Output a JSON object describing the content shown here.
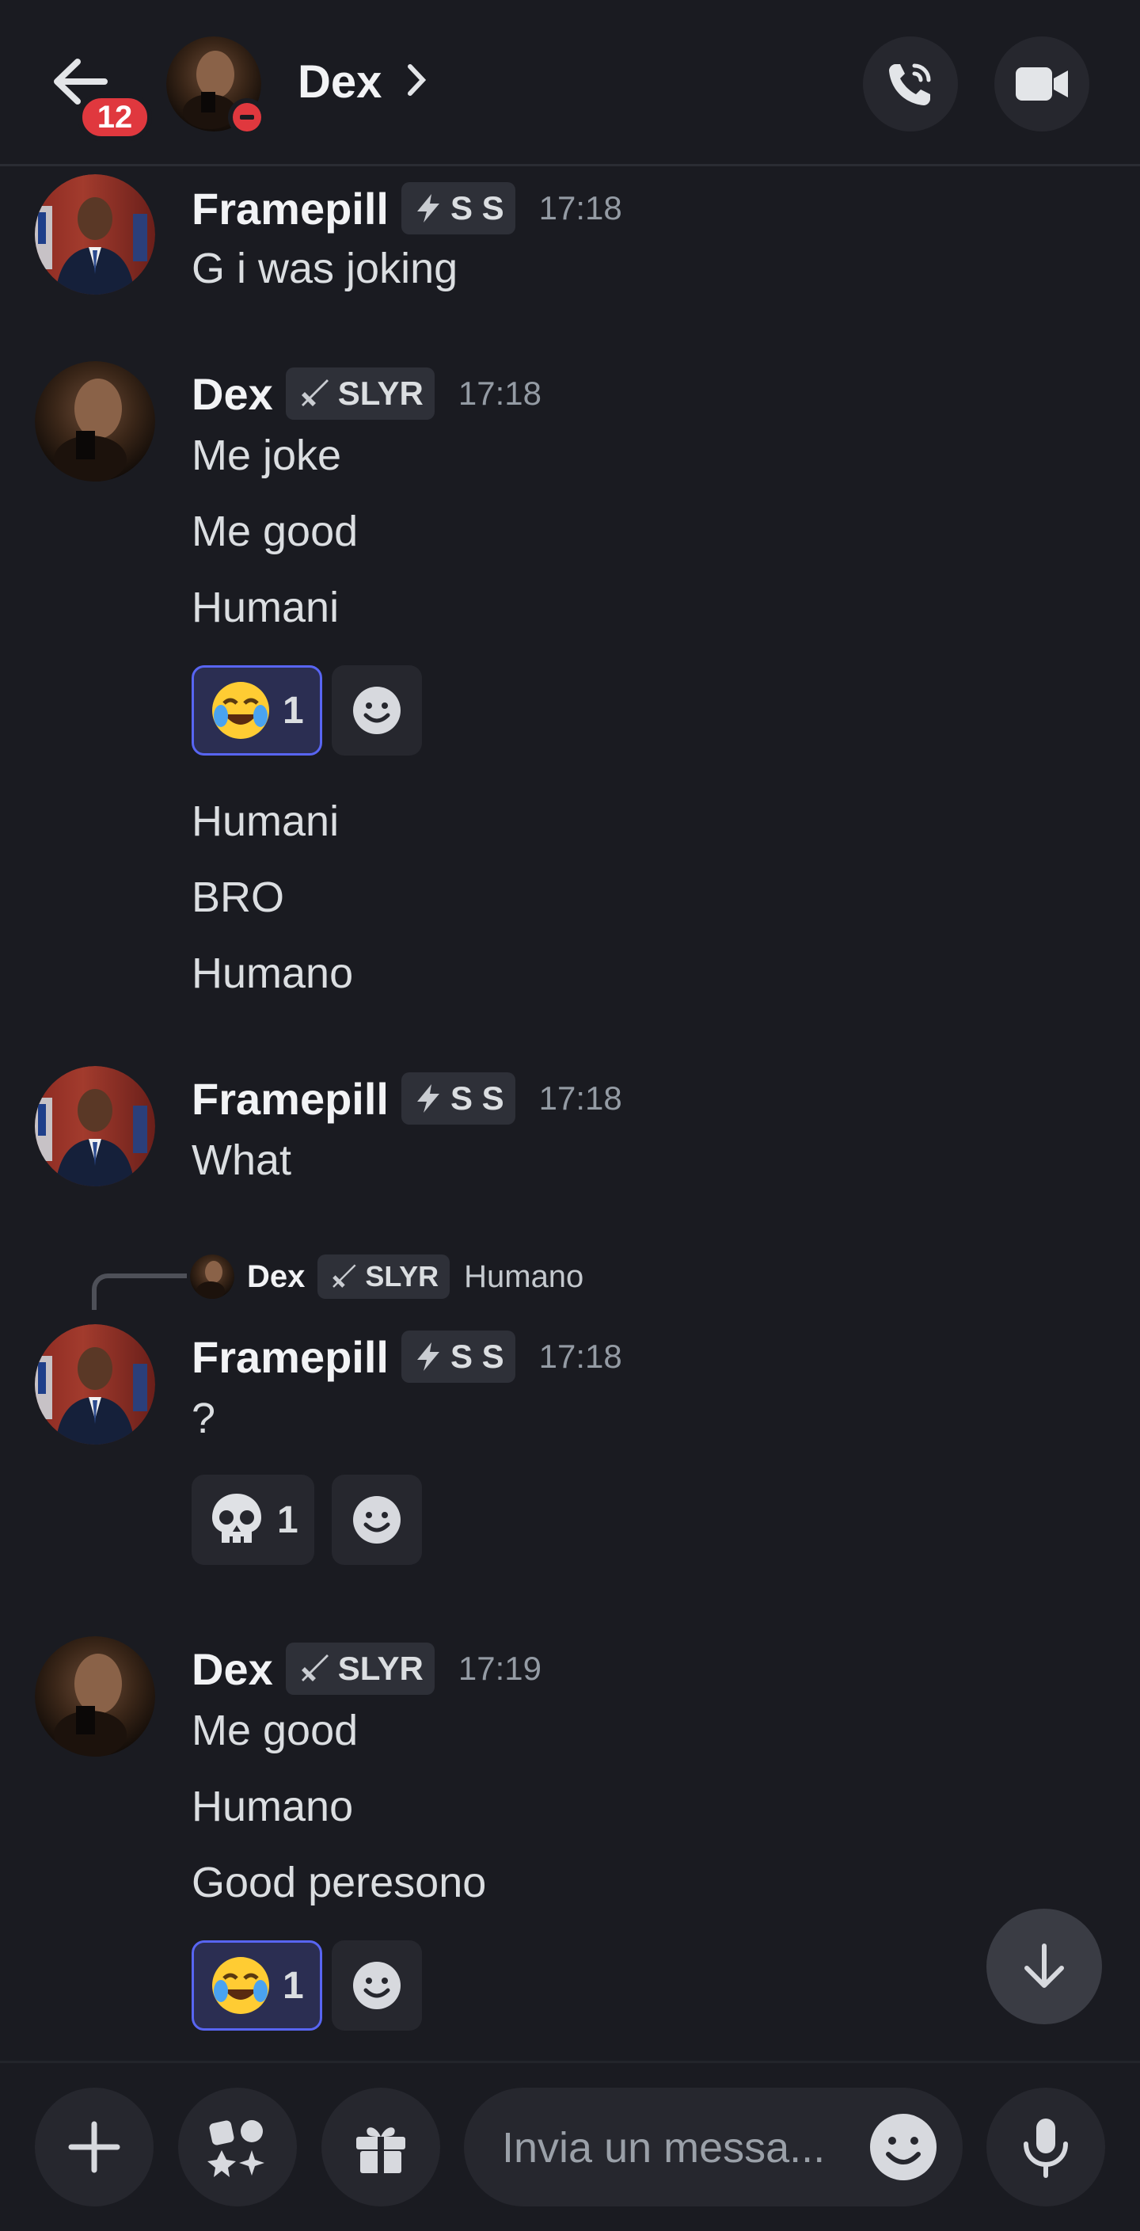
{
  "header": {
    "back_icon": "arrow-left-icon",
    "unread_badge": "12",
    "contact_name": "Dex",
    "status": "do-not-disturb",
    "call_icon": "phone-call-icon",
    "video_icon": "video-camera-icon"
  },
  "messages": [
    {
      "author": "Framepill",
      "tag": "S S",
      "tag_icon": "lightning-icon",
      "time": "17:18",
      "lines": [
        "G i was joking"
      ]
    },
    {
      "author": "Dex",
      "tag": "SLYR",
      "tag_icon": "sword-icon",
      "time": "17:18",
      "lines": [
        "Me joke",
        "Me good",
        "Humani"
      ],
      "reaction": {
        "emoji": "😂",
        "count": "1",
        "active": true
      },
      "more_lines": [
        "Humani",
        "BRO",
        "Humano"
      ]
    },
    {
      "author": "Framepill",
      "tag": "S S",
      "tag_icon": "lightning-icon",
      "time": "17:18",
      "lines": [
        "What"
      ]
    },
    {
      "reply_to": {
        "author": "Dex",
        "tag": "SLYR",
        "text": "Humano"
      },
      "author": "Framepill",
      "tag": "S S",
      "tag_icon": "lightning-icon",
      "time": "17:18",
      "lines": [
        "?"
      ],
      "reaction": {
        "emoji": "💀",
        "count": "1",
        "active": false
      }
    },
    {
      "author": "Dex",
      "tag": "SLYR",
      "tag_icon": "sword-icon",
      "time": "17:19",
      "lines": [
        "Me good",
        "Humano",
        "Good peresono"
      ],
      "reaction": {
        "emoji": "😂",
        "count": "1",
        "active": true
      }
    }
  ],
  "composer": {
    "placeholder": "Invia un messa...",
    "plus_icon": "plus-icon",
    "apps_icon": "apps-icon",
    "gift_icon": "gift-icon",
    "emoji_icon": "emoji-icon",
    "mic_icon": "microphone-icon"
  },
  "colors": {
    "background": "#1a1b21",
    "accent": "#5865f2",
    "danger": "#e0383e"
  }
}
